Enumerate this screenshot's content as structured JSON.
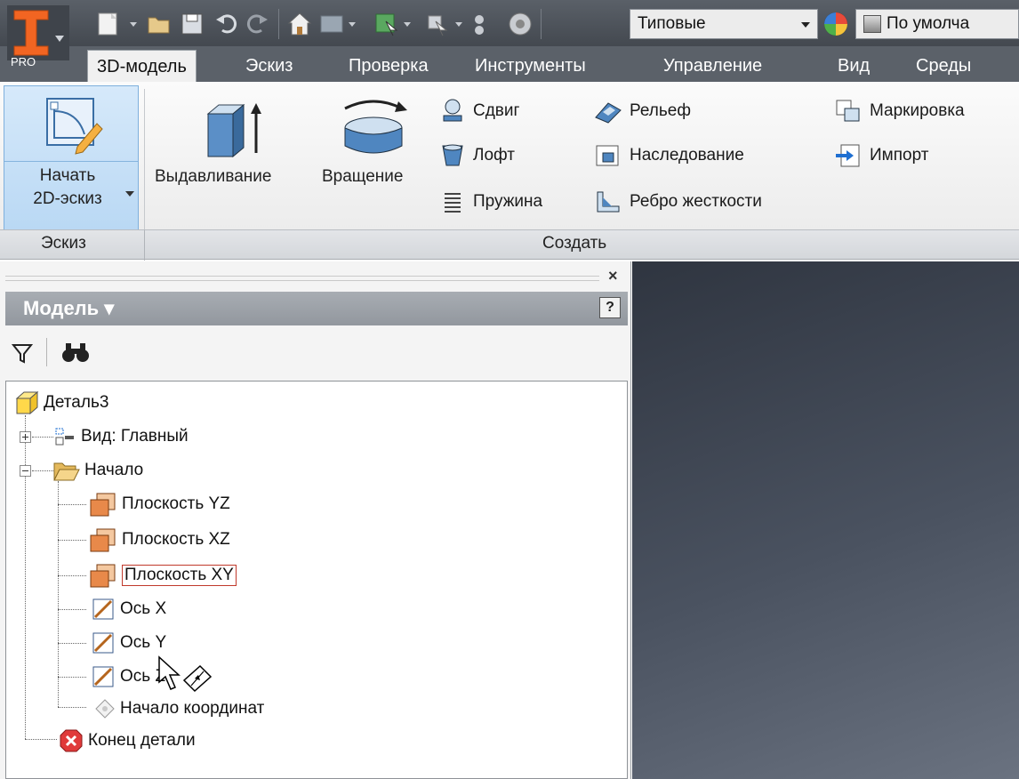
{
  "app": {
    "edition_badge": "PRO"
  },
  "qat": {
    "appearance_select": "Типовые",
    "material_select": "По умолча"
  },
  "tabs": [
    {
      "label": "3D-модель",
      "active": true
    },
    {
      "label": "Эскиз"
    },
    {
      "label": "Проверка"
    },
    {
      "label": "Инструменты"
    },
    {
      "label": "Управление"
    },
    {
      "label": "Вид"
    },
    {
      "label": "Среды"
    }
  ],
  "ribbon": {
    "start_sketch_line1": "Начать",
    "start_sketch_line2": "2D-эскиз",
    "extrude": "Выдавливание",
    "revolve": "Вращение",
    "sweep": "Сдвиг",
    "loft": "Лофт",
    "coil": "Пружина",
    "emboss": "Рельеф",
    "derive": "Наследование",
    "rib": "Ребро жесткости",
    "mark": "Маркировка",
    "import": "Импорт",
    "panel_sketch": "Эскиз",
    "panel_create": "Создать"
  },
  "browser": {
    "title": "Модель ▾",
    "help": "?",
    "close": "×",
    "tree": {
      "root": "Деталь3",
      "view": "Вид: Главный",
      "origin": "Начало",
      "plane_yz": "Плоскость YZ",
      "plane_xz": "Плоскость XZ",
      "plane_xy": "Плоскость XY",
      "axis_x": "Ось X",
      "axis_y": "Ось Y",
      "axis_z": "Ось Z",
      "center_point": "Начало координат",
      "end_of_part": "Конец детали"
    }
  },
  "colors": {
    "qat_bg": "#4a4f56",
    "ribbon_bg": "#f3f3f3",
    "sketch_highlight": "#c4def6",
    "viewport_bg": "#3d4452",
    "logo_orange": "#f26522",
    "selection_border": "#c0392b"
  }
}
